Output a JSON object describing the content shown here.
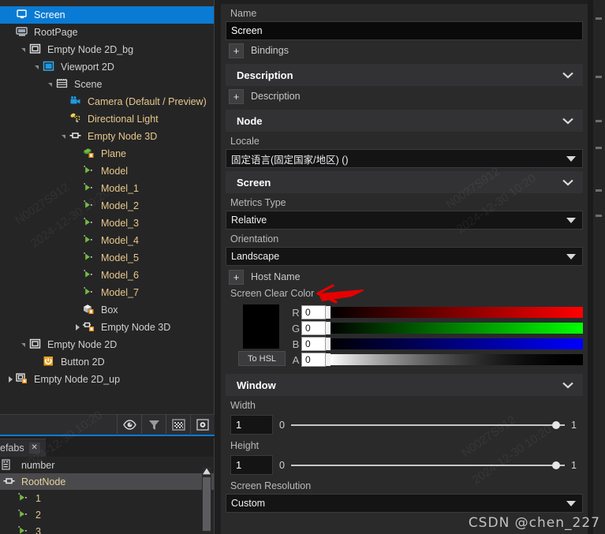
{
  "scene_tree": {
    "rows": [
      {
        "label": "Screen",
        "depth": 0,
        "icon": "screen-icon",
        "toggle": "none",
        "selected": true,
        "color": "white"
      },
      {
        "label": "RootPage",
        "depth": 0,
        "icon": "page-icon",
        "toggle": "none",
        "selected": false,
        "color": "default"
      },
      {
        "label": "Empty Node 2D_bg",
        "depth": 1,
        "icon": "node2d-icon",
        "toggle": "down",
        "selected": false,
        "color": "default"
      },
      {
        "label": "Viewport 2D",
        "depth": 2,
        "icon": "viewport-icon",
        "toggle": "down",
        "selected": false,
        "color": "default"
      },
      {
        "label": "Scene",
        "depth": 3,
        "icon": "scene-icon",
        "toggle": "down",
        "selected": false,
        "color": "default"
      },
      {
        "label": "Camera (Default / Preview)",
        "depth": 4,
        "icon": "camera-icon",
        "toggle": "none",
        "selected": false,
        "color": "amber"
      },
      {
        "label": "Directional Light",
        "depth": 4,
        "icon": "light-icon",
        "toggle": "none",
        "selected": false,
        "color": "amber"
      },
      {
        "label": "Empty Node 3D",
        "depth": 4,
        "icon": "node3d-icon",
        "toggle": "down",
        "selected": false,
        "color": "amber"
      },
      {
        "label": "Plane",
        "depth": 5,
        "icon": "plane-icon",
        "toggle": "none",
        "selected": false,
        "color": "amber"
      },
      {
        "label": "Model",
        "depth": 5,
        "icon": "model-icon",
        "toggle": "none",
        "selected": false,
        "color": "amber"
      },
      {
        "label": "Model_1",
        "depth": 5,
        "icon": "model-icon",
        "toggle": "none",
        "selected": false,
        "color": "amber"
      },
      {
        "label": "Model_2",
        "depth": 5,
        "icon": "model-icon",
        "toggle": "none",
        "selected": false,
        "color": "amber"
      },
      {
        "label": "Model_3",
        "depth": 5,
        "icon": "model-icon",
        "toggle": "none",
        "selected": false,
        "color": "amber"
      },
      {
        "label": "Model_4",
        "depth": 5,
        "icon": "model-icon",
        "toggle": "none",
        "selected": false,
        "color": "amber"
      },
      {
        "label": "Model_5",
        "depth": 5,
        "icon": "model-icon",
        "toggle": "none",
        "selected": false,
        "color": "amber"
      },
      {
        "label": "Model_6",
        "depth": 5,
        "icon": "model-icon",
        "toggle": "none",
        "selected": false,
        "color": "amber"
      },
      {
        "label": "Model_7",
        "depth": 5,
        "icon": "model-icon",
        "toggle": "none",
        "selected": false,
        "color": "amber"
      },
      {
        "label": "Box",
        "depth": 5,
        "icon": "box-icon",
        "toggle": "none",
        "selected": false,
        "color": "default"
      },
      {
        "label": "Empty Node 3D",
        "depth": 5,
        "icon": "node3d-prefab-icon",
        "toggle": "right",
        "selected": false,
        "color": "default"
      },
      {
        "label": "Empty Node 2D",
        "depth": 1,
        "icon": "node2d-icon",
        "toggle": "down",
        "selected": false,
        "color": "default"
      },
      {
        "label": "Button 2D",
        "depth": 2,
        "icon": "button2d-icon",
        "toggle": "none",
        "selected": false,
        "color": "default"
      },
      {
        "label": "Empty Node 2D_up",
        "depth": 0,
        "icon": "node2d-prefab-icon",
        "toggle": "right",
        "selected": false,
        "color": "default"
      }
    ],
    "toolbar": [
      {
        "name": "eye-icon",
        "title": "Visibility"
      },
      {
        "name": "filter-icon",
        "title": "Filter"
      },
      {
        "name": "grid-icon",
        "title": "Grid"
      },
      {
        "name": "target-icon",
        "title": "Target"
      }
    ]
  },
  "prefabs": {
    "tab_label": "efabs",
    "tab_close": "✕",
    "header_label": "number",
    "rows": [
      {
        "label": "RootNode",
        "icon": "node3d-icon",
        "selected": true,
        "indent": 0
      },
      {
        "label": "1",
        "icon": "model-icon",
        "selected": false,
        "indent": 1
      },
      {
        "label": "2",
        "icon": "model-icon",
        "selected": false,
        "indent": 1
      },
      {
        "label": "3",
        "icon": "model-icon",
        "selected": false,
        "indent": 1
      }
    ]
  },
  "properties": {
    "name_label": "Name",
    "name_value": "Screen",
    "bindings_label": "Bindings",
    "bindings_plus": "+",
    "sections": {
      "description": "Description",
      "node": "Node",
      "screen": "Screen",
      "window": "Window"
    },
    "description_plus_label": "Description",
    "description_plus": "+",
    "locale_label": "Locale",
    "locale_value": "固定语言(固定国家/地区) ()",
    "metrics_type_label": "Metrics Type",
    "metrics_type_value": "Relative",
    "orientation_label": "Orientation",
    "orientation_value": "Landscape",
    "host_name_label": "Host Name",
    "host_name_plus": "+",
    "clear_color_label": "Screen Clear Color",
    "to_hsl_label": "To HSL",
    "channels": [
      {
        "name": "R",
        "value": "0"
      },
      {
        "name": "G",
        "value": "0"
      },
      {
        "name": "B",
        "value": "0"
      },
      {
        "name": "A",
        "value": "0"
      }
    ],
    "swatch_color": "#000000",
    "width_label": "Width",
    "width_value": "1",
    "width_min": "0",
    "width_max": "1",
    "height_label": "Height",
    "height_value": "1",
    "height_min": "0",
    "height_max": "1",
    "screen_resolution_label": "Screen Resolution",
    "screen_resolution_value": "Custom"
  },
  "watermarks": {
    "bottom_right": "CSDN @chen_227",
    "diag_1": "N0027S912",
    "diag_2": "2024-12-30 10:20"
  },
  "colors": {
    "accent": "#0a7bd4",
    "panel_bg": "#2a2a2b",
    "tree_bg": "#252526",
    "amber_text": "#e8c88a"
  }
}
